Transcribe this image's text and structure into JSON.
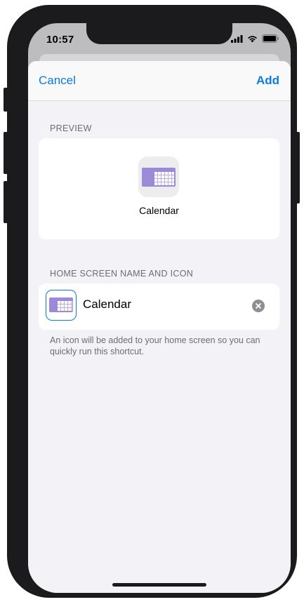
{
  "status_bar": {
    "time": "10:57",
    "icons": [
      "signal-icon",
      "wifi-icon",
      "battery-icon"
    ]
  },
  "nav": {
    "cancel_label": "Cancel",
    "add_label": "Add"
  },
  "preview": {
    "section_label": "PREVIEW",
    "shortcut_name": "Calendar",
    "icon": "calendar-icon"
  },
  "home_screen": {
    "section_label": "HOME SCREEN NAME AND ICON",
    "name_value": "Calendar",
    "icon": "calendar-icon",
    "footnote": "An icon will be added to your home screen so you can quickly run this shortcut."
  },
  "colors": {
    "accent": "#0a7cde",
    "background": "#f2f2f7",
    "card": "#ffffff",
    "secondary_text": "#6d6d72",
    "calendar_purple": "#9b8ad8",
    "device_frame": "#1b1b1d"
  }
}
